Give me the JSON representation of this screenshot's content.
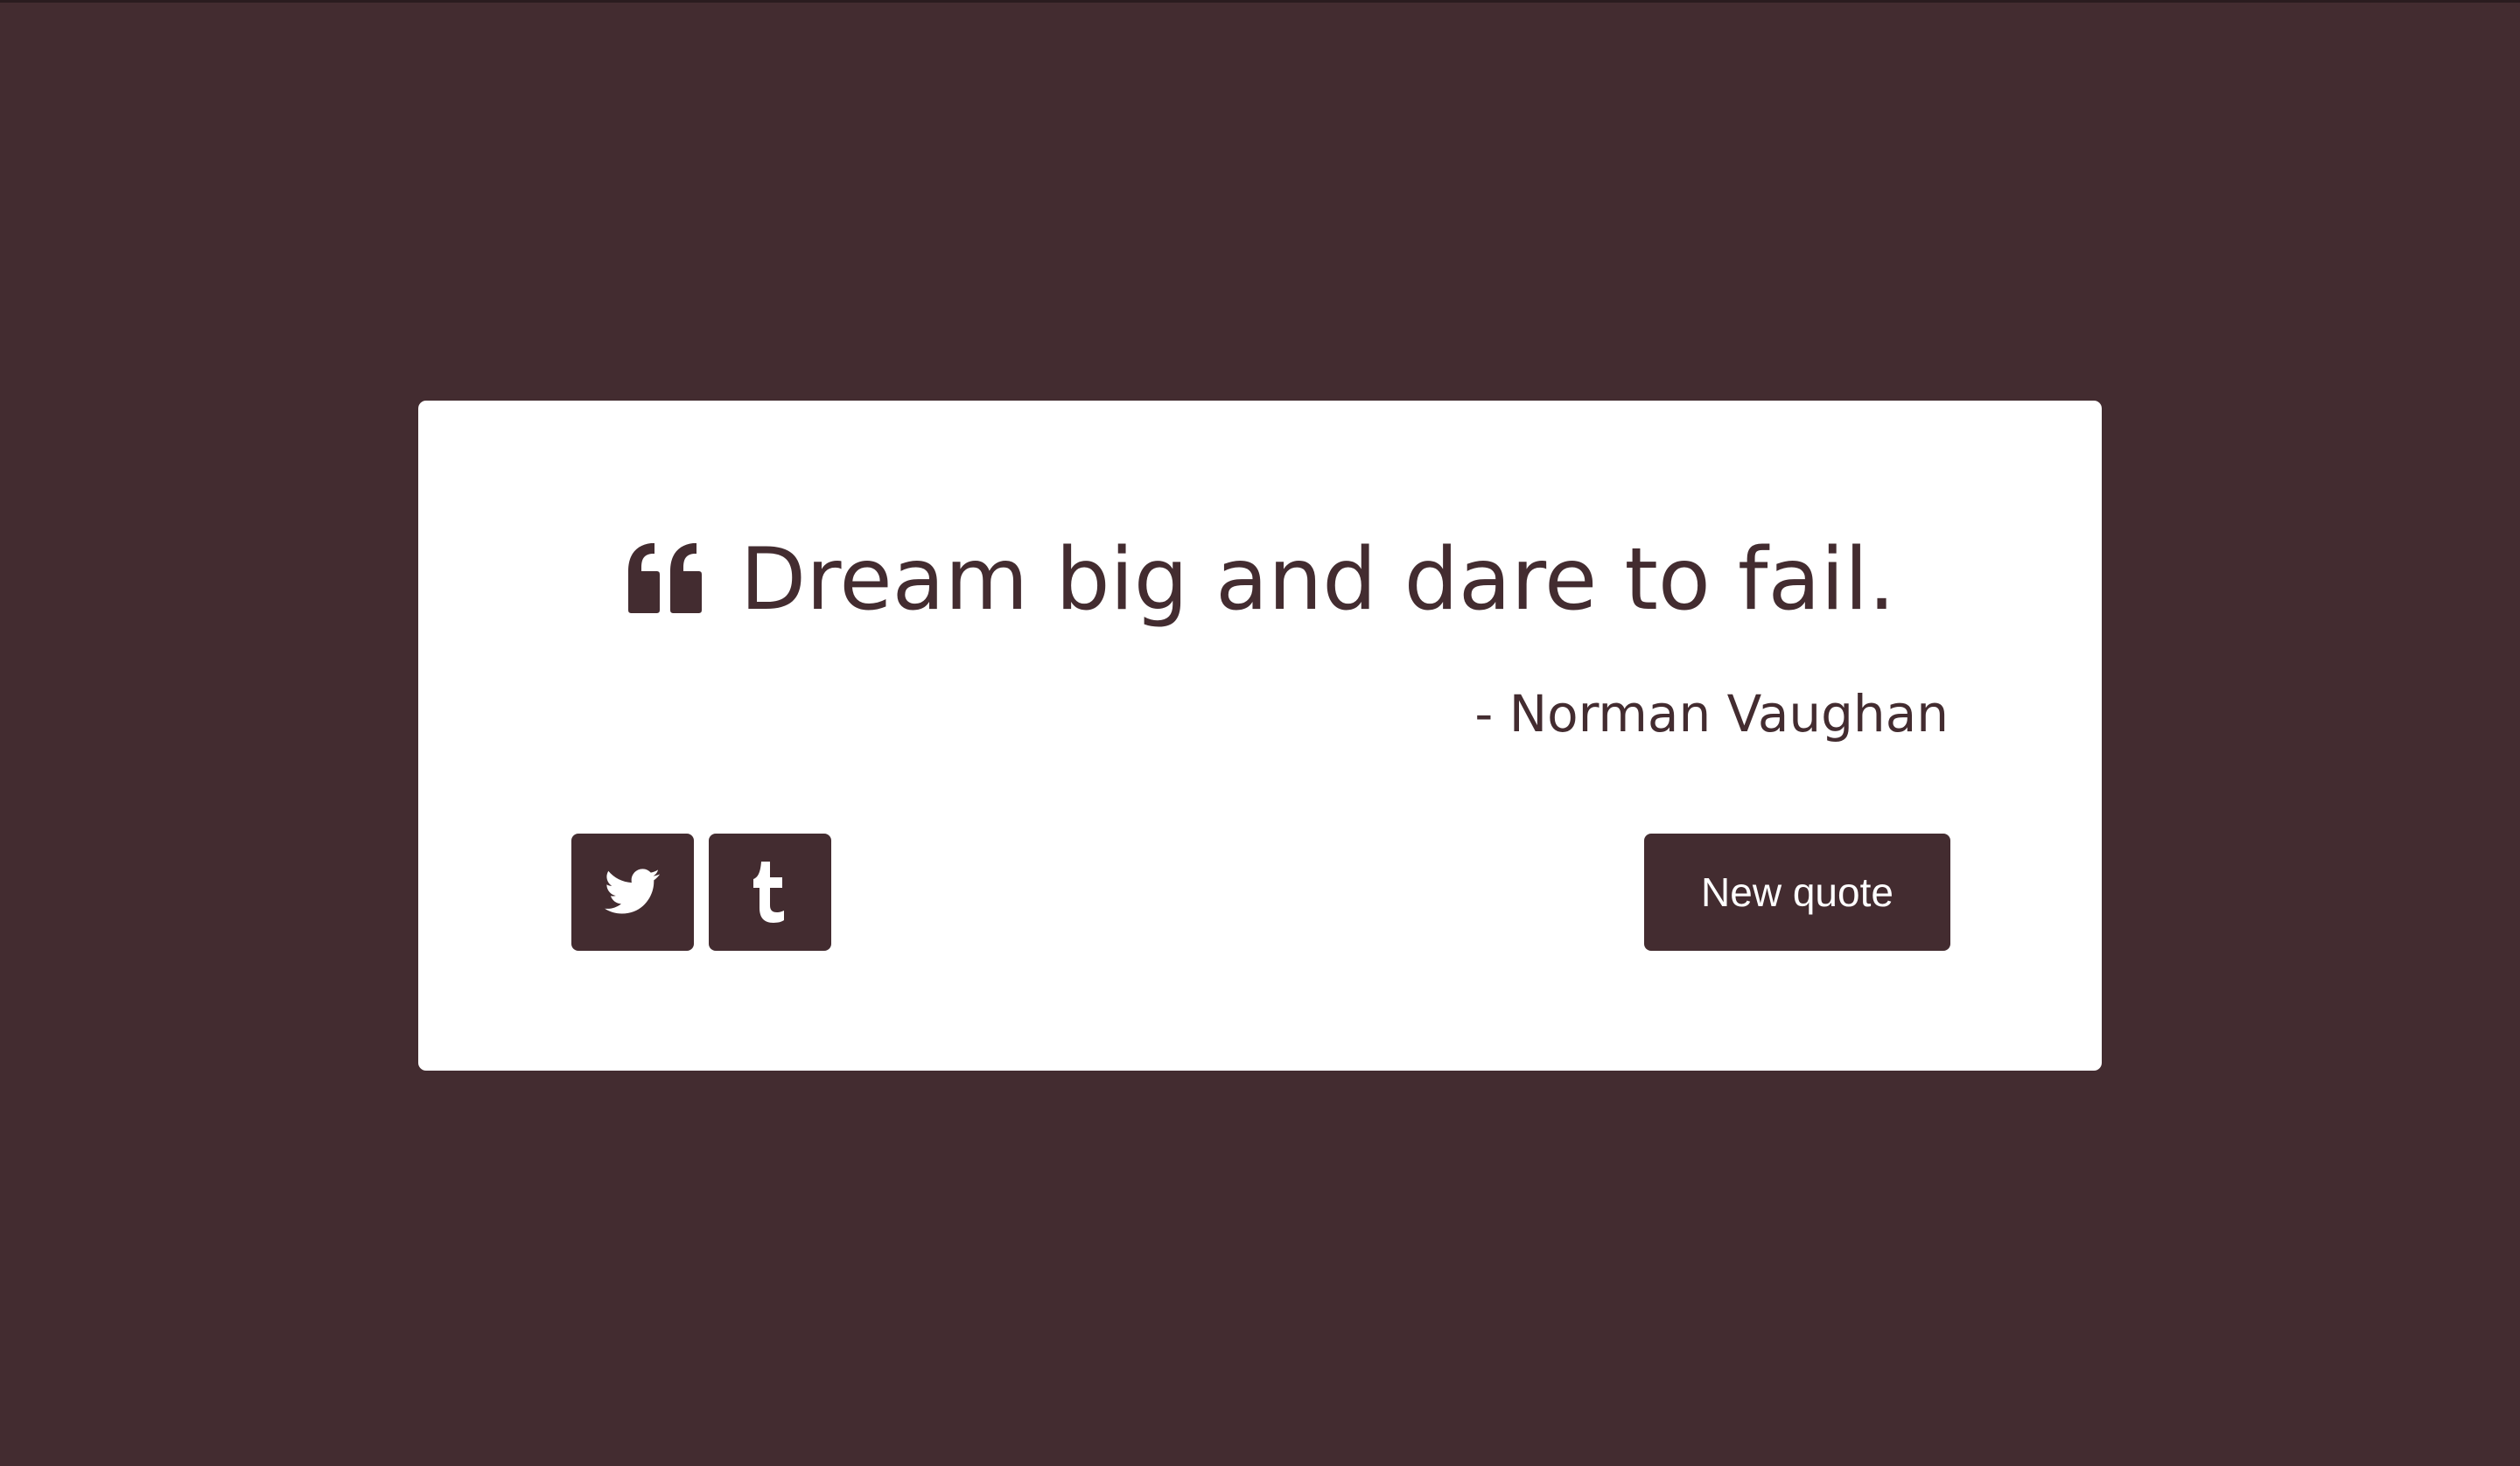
{
  "quote": {
    "icon": "quote-left-icon",
    "text": "Dream big and dare to fail.",
    "author": "- Norman Vaughan"
  },
  "actions": {
    "tweet_icon": "twitter-icon",
    "tumblr_icon": "tumblr-icon",
    "new_quote_label": "New quote"
  },
  "colors": {
    "background": "#432c30",
    "card": "#ffffff",
    "accent": "#432c30",
    "button_text": "#ffffff"
  }
}
